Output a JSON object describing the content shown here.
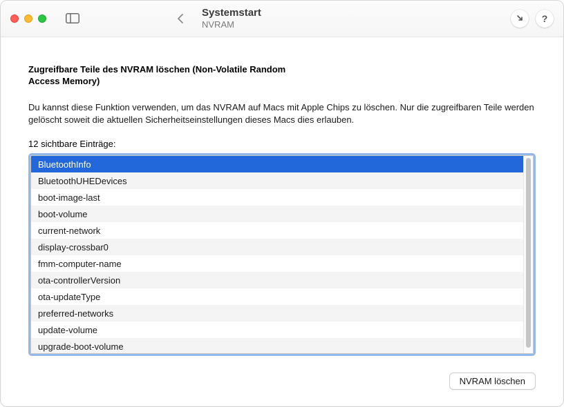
{
  "header": {
    "title": "Systemstart",
    "subtitle": "NVRAM"
  },
  "main": {
    "heading": "Zugreifbare Teile des NVRAM löschen (Non-Volatile Random Access Memory)",
    "description": "Du kannst diese Funktion verwenden, um das NVRAM auf Macs mit Apple Chips zu löschen. Nur die zugreifbaren Teile werden gelöscht soweit die aktuellen Sicherheitseinstellungen dieses Macs dies erlauben.",
    "count_label": "12 sichtbare Einträge:",
    "entries": [
      "BluetoothInfo",
      "BluetoothUHEDevices",
      "boot-image-last",
      "boot-volume",
      "current-network",
      "display-crossbar0",
      "fmm-computer-name",
      "ota-controllerVersion",
      "ota-updateType",
      "preferred-networks",
      "update-volume",
      "upgrade-boot-volume"
    ],
    "selected_index": 0,
    "action_button": "NVRAM löschen"
  }
}
